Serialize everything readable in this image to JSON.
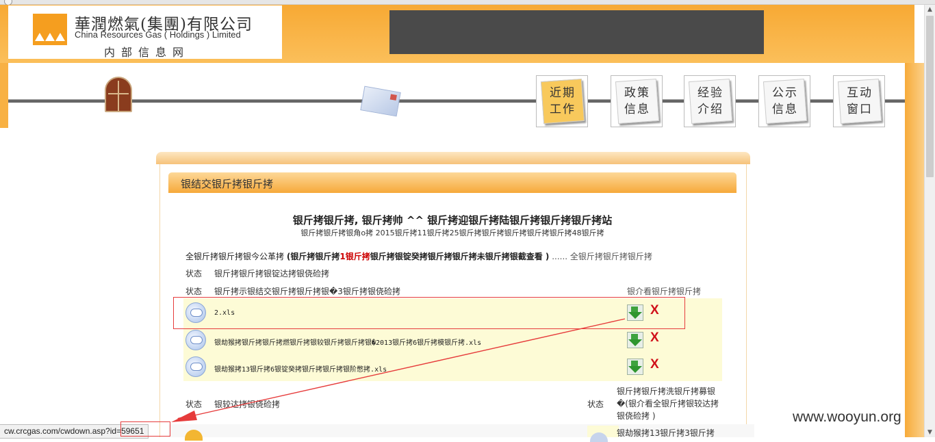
{
  "header": {
    "company_cn": "華潤燃氣(集團)有限公司",
    "company_en": "China Resources Gas ( Holdings ) Limited",
    "intranet_label": "内部信息网"
  },
  "nav": {
    "buttons": [
      {
        "line1": "近期",
        "line2": "工作"
      },
      {
        "line1": "政策",
        "line2": "信息"
      },
      {
        "line1": "经验",
        "line2": "介绍"
      },
      {
        "line1": "公示",
        "line2": "信息"
      },
      {
        "line1": "互动",
        "line2": "窗口"
      }
    ]
  },
  "section": {
    "title": "银结交银斤拷银斤拷"
  },
  "content": {
    "title": "银斤拷银斤拷, 银斤拷帅 ^^ 银斤拷迎银斤拷陆银斤拷银斤拷银斤拷站",
    "subtitle": "银斤拷银斤拷银角ο拷 2015银斤拷11银斤拷25银斤拷银斤拷银斤拷银斤拷银斤拷48银斤拷",
    "notice_prefix": "全银斤拷银斤拷银今公革拷",
    "notice_bold_a": "(银斤拷银斤拷",
    "notice_red": "1银斤拷",
    "notice_bold_b": "银斤拷银锭癸拷银斤拷银斤拷未银斤拷银截查看 )",
    "notice_dots": "......",
    "notice_suffix": "全银斤拷银斤拷银斤拷",
    "row1_status": "状态",
    "row1_text": "银斤拷银斤拷银锭达拷银侥硷拷",
    "row2_status": "状态",
    "row2_text": "银斤拷示银结交银斤拷银斤拷银�3银斤拷银侥硷拷",
    "row2_right": "银介看银斤拷银斤拷",
    "files": [
      {
        "name": "2.xls",
        "delete_label": "X"
      },
      {
        "name": "银劫猴拷银斤拷银斤拷燃银斤拷银较银斤拷银斤拷银�2013银斤拷6银斤拷模银斤拷.xls",
        "delete_label": "X"
      },
      {
        "name": "银劫猴拷13银斤拷6银锭癸拷银斤拷银斤拷银阶憋拷.xls",
        "delete_label": "X"
      }
    ],
    "row3_status": "状态",
    "row3_text": "银较达拷银侥硷拷",
    "row3_status_right": "状态",
    "row3_right_text": "银斤拷银斤拷洗银斤拷募银�(银介看全银斤拷银较达拷银侥硷拷 )",
    "row4_right_text": "银劫猴拷13银斤拷3银斤拷"
  },
  "statusbar": {
    "url": "cw.crcgas.com/cwdown.asp?id=59651"
  },
  "watermark": "www.wooyun.org",
  "colors": {
    "header_orange": "#f7a934",
    "annotation_red": "#e63b3b",
    "delete_red": "#d0101a",
    "file_row_bg": "#fdfbd6"
  }
}
